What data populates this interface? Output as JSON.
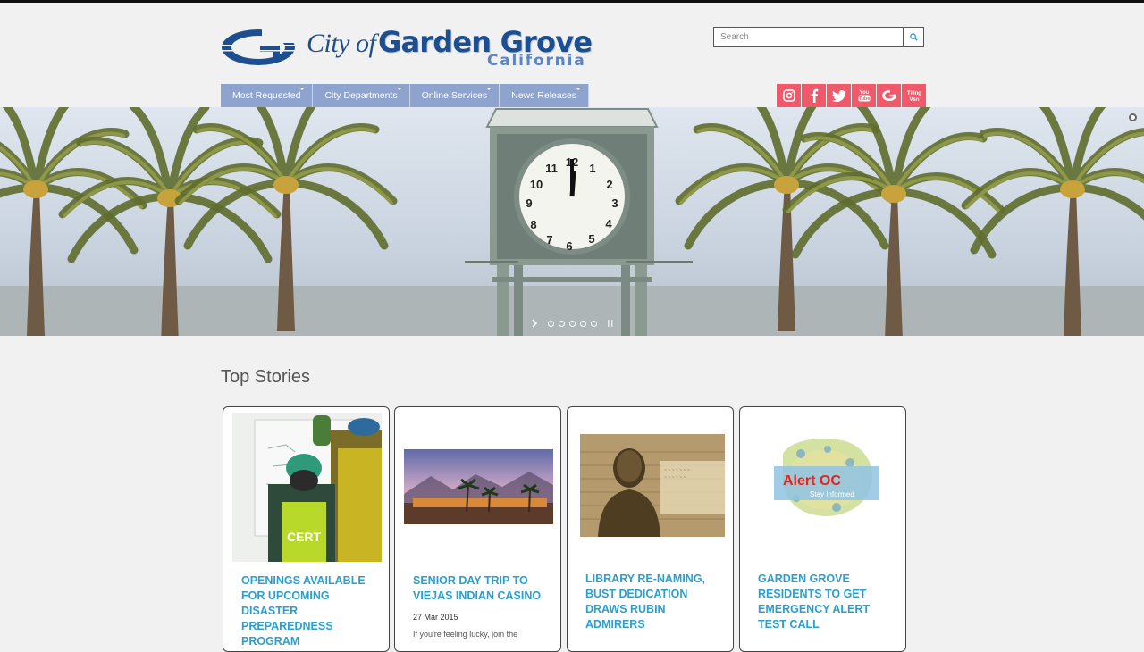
{
  "header": {
    "logo": {
      "city_of": "City of",
      "name": "Garden Grove",
      "state": "California"
    },
    "search": {
      "placeholder": "Search"
    }
  },
  "nav": {
    "items": [
      {
        "label": "Most Requested"
      },
      {
        "label": "City Departments"
      },
      {
        "label": "Online Services"
      },
      {
        "label": "News Releases"
      }
    ]
  },
  "social": {
    "icons": [
      "instagram-icon",
      "facebook-icon",
      "twitter-icon",
      "youtube-icon",
      "gg-icon",
      "tiling-vision-icon"
    ],
    "tiling_label": "Tiling Vsn"
  },
  "hero": {
    "slides_count": 5,
    "active_slide": 1
  },
  "top_stories": {
    "title": "Top Stories",
    "cards": [
      {
        "title": "OPENINGS AVAILABLE FOR UPCOMING DISASTER PREPAREDNESS PROGRAM",
        "date": "",
        "snippet": "",
        "image_text": "CERT"
      },
      {
        "title": "SENIOR DAY TRIP TO VIEJAS INDIAN CASINO",
        "date": "27 Mar 2015",
        "snippet": "If you're feeling lucky, join the",
        "image_text": ""
      },
      {
        "title": "LIBRARY RE-NAMING, BUST DEDICATION DRAWS RUBIN ADMIRERS",
        "date": "",
        "snippet": "",
        "image_text": ""
      },
      {
        "title": "GARDEN GROVE RESIDENTS TO GET EMERGENCY ALERT TEST CALL",
        "date": "",
        "snippet": "",
        "image_text": "Alert OC",
        "image_subtext": "Stay Informed"
      }
    ]
  },
  "colors": {
    "nav_bg": "#8ea4ce",
    "social_bg": "#f0596a",
    "link_blue": "#2a9fd0",
    "logo_blue": "#1d4e8f"
  }
}
